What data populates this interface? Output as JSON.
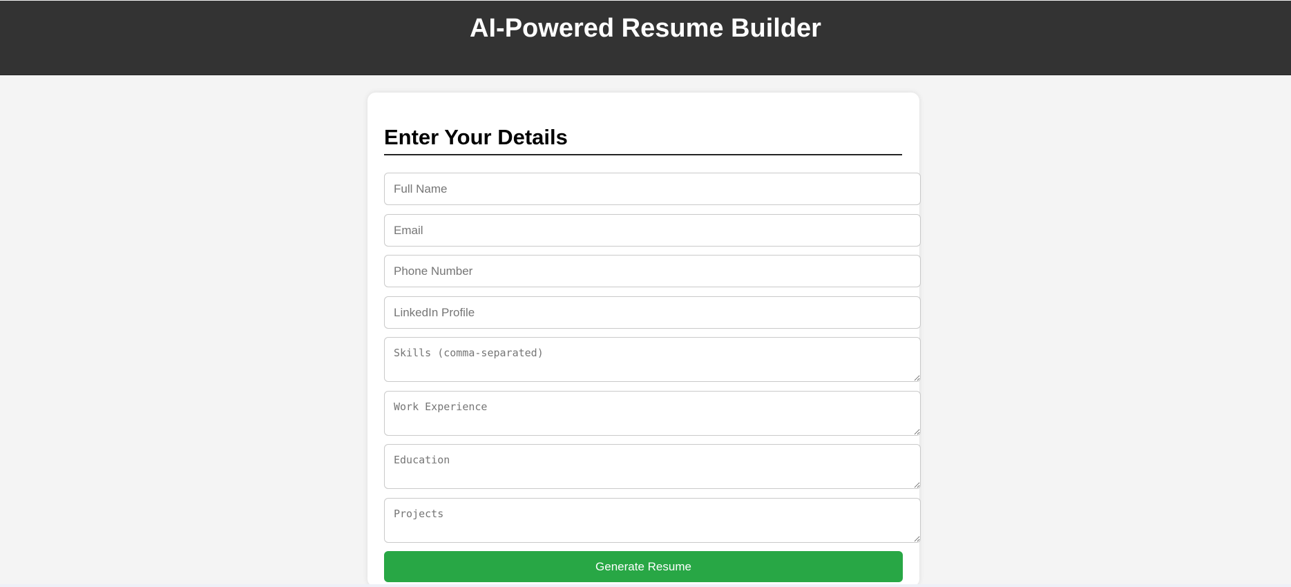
{
  "header": {
    "title": "AI-Powered Resume Builder"
  },
  "form": {
    "title": "Enter Your Details",
    "fields": {
      "full_name": {
        "placeholder": "Full Name",
        "value": ""
      },
      "email": {
        "placeholder": "Email",
        "value": ""
      },
      "phone": {
        "placeholder": "Phone Number",
        "value": ""
      },
      "linkedin": {
        "placeholder": "LinkedIn Profile",
        "value": ""
      },
      "skills": {
        "placeholder": "Skills (comma-separated)",
        "value": ""
      },
      "experience": {
        "placeholder": "Work Experience",
        "value": ""
      },
      "education": {
        "placeholder": "Education",
        "value": ""
      },
      "projects": {
        "placeholder": "Projects",
        "value": ""
      }
    },
    "submit_label": "Generate Resume"
  },
  "colors": {
    "header_bg": "#333333",
    "page_bg": "#f4f4f4",
    "button_bg": "#28a745"
  }
}
